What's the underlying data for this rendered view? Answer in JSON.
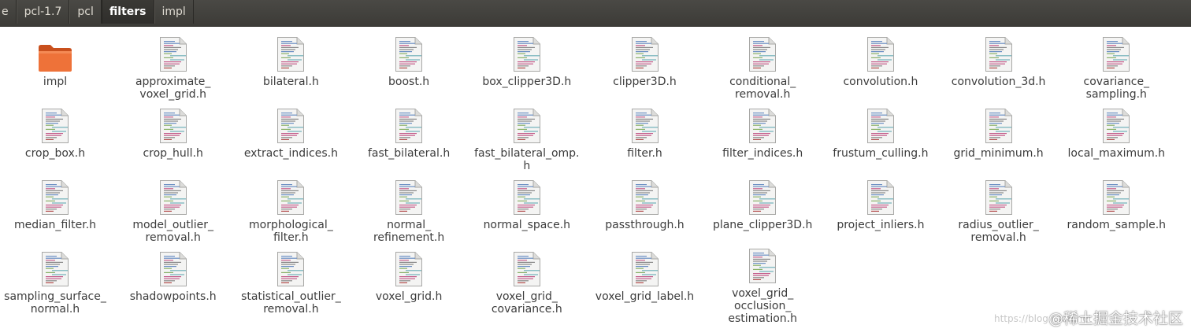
{
  "breadcrumbs": [
    {
      "label": "e",
      "active": false
    },
    {
      "label": "pcl-1.7",
      "active": false
    },
    {
      "label": "pcl",
      "active": false
    },
    {
      "label": "filters",
      "active": true
    },
    {
      "label": "impl",
      "active": false
    }
  ],
  "files": [
    {
      "name": "impl",
      "kind": "folder"
    },
    {
      "name": "approximate_\nvoxel_grid.h",
      "kind": "header"
    },
    {
      "name": "bilateral.h",
      "kind": "header"
    },
    {
      "name": "boost.h",
      "kind": "header"
    },
    {
      "name": "box_clipper3D.h",
      "kind": "header"
    },
    {
      "name": "clipper3D.h",
      "kind": "header"
    },
    {
      "name": "conditional_\nremoval.h",
      "kind": "header"
    },
    {
      "name": "convolution.h",
      "kind": "header"
    },
    {
      "name": "convolution_3d.h",
      "kind": "header"
    },
    {
      "name": "covariance_\nsampling.h",
      "kind": "header"
    },
    {
      "name": "crop_box.h",
      "kind": "header"
    },
    {
      "name": "crop_hull.h",
      "kind": "header"
    },
    {
      "name": "extract_indices.h",
      "kind": "header"
    },
    {
      "name": "fast_bilateral.h",
      "kind": "header"
    },
    {
      "name": "fast_bilateral_omp.\nh",
      "kind": "header"
    },
    {
      "name": "filter.h",
      "kind": "header"
    },
    {
      "name": "filter_indices.h",
      "kind": "header"
    },
    {
      "name": "frustum_culling.h",
      "kind": "header"
    },
    {
      "name": "grid_minimum.h",
      "kind": "header"
    },
    {
      "name": "local_maximum.h",
      "kind": "header"
    },
    {
      "name": "median_filter.h",
      "kind": "header"
    },
    {
      "name": "model_outlier_\nremoval.h",
      "kind": "header"
    },
    {
      "name": "morphological_\nfilter.h",
      "kind": "header"
    },
    {
      "name": "normal_\nrefinement.h",
      "kind": "header"
    },
    {
      "name": "normal_space.h",
      "kind": "header"
    },
    {
      "name": "passthrough.h",
      "kind": "header"
    },
    {
      "name": "plane_clipper3D.h",
      "kind": "header"
    },
    {
      "name": "project_inliers.h",
      "kind": "header"
    },
    {
      "name": "radius_outlier_\nremoval.h",
      "kind": "header"
    },
    {
      "name": "random_sample.h",
      "kind": "header"
    },
    {
      "name": "sampling_surface_\nnormal.h",
      "kind": "header"
    },
    {
      "name": "shadowpoints.h",
      "kind": "header"
    },
    {
      "name": "statistical_outlier_\nremoval.h",
      "kind": "header"
    },
    {
      "name": "voxel_grid.h",
      "kind": "header"
    },
    {
      "name": "voxel_grid_\ncovariance.h",
      "kind": "header"
    },
    {
      "name": "voxel_grid_label.h",
      "kind": "header"
    },
    {
      "name": "voxel_grid_\nocclusion_\nestimation.h",
      "kind": "header"
    }
  ],
  "watermark": "@稀土掘金技术社区",
  "watermark_faint": "https://blog.csdn.net",
  "colors": {
    "pathbar_bg": "#3c3b37",
    "folder_orange": "#e3672c",
    "text": "#3c3c3c"
  }
}
